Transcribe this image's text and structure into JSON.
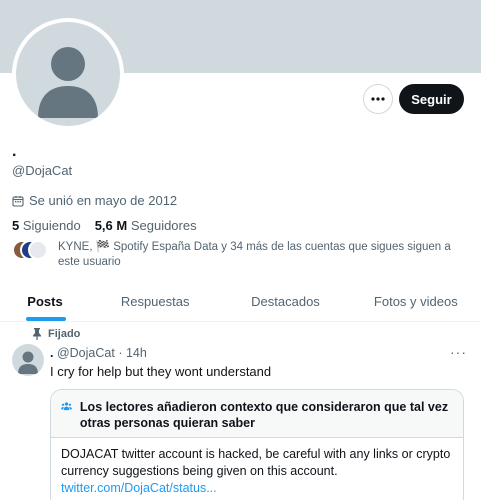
{
  "profile": {
    "display_name": ".",
    "handle": "@DojaCat",
    "joined": "Se unió en mayo de 2012",
    "following_count": "5",
    "following_label": "Siguiendo",
    "followers_count": "5,6 M",
    "followers_label": "Seguidores",
    "followed_by": "KYNE, 🏁 Spotify España Data y 34 más de las cuentas que sigues siguen a este usuario"
  },
  "actions": {
    "more_icon": "ellipsis-icon",
    "follow_label": "Seguir"
  },
  "tabs": [
    {
      "label": "Posts",
      "active": true
    },
    {
      "label": "Respuestas",
      "active": false
    },
    {
      "label": "Destacados",
      "active": false
    },
    {
      "label": "Fotos y videos",
      "active": false
    }
  ],
  "pinned_tweet": {
    "pinned_label": "Fijado",
    "author_name": ".",
    "author_handle": "@DojaCat",
    "separator": "·",
    "time": "14h",
    "more": "···",
    "text": "I cry for help but they wont understand",
    "community_note": {
      "title": "Los lectores añadieron contexto que consideraron que tal vez otras personas quieran saber",
      "body": "DOJACAT twitter account is hacked, be careful with any links or crypto currency suggestions being given on this account.",
      "link": "twitter.com/DojaCat/status..."
    }
  },
  "colors": {
    "accent": "#1d9bf0",
    "banner": "#cfd9de",
    "text_primary": "#0f1419",
    "text_secondary": "#536471"
  }
}
